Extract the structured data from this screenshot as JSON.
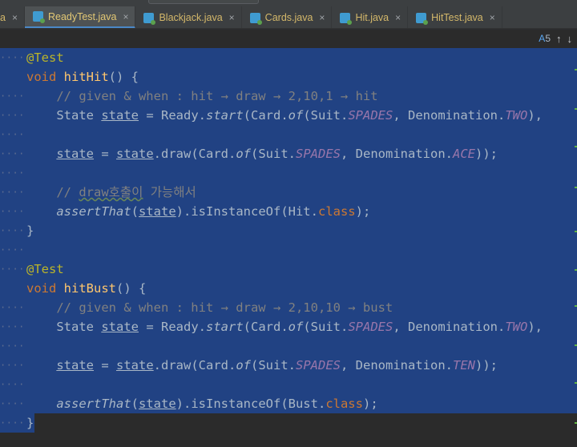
{
  "tabs": [
    {
      "label": "a",
      "active": false,
      "icon": "none"
    },
    {
      "label": "ReadyTest.java",
      "active": true,
      "icon": "java-class-icon"
    },
    {
      "label": "Blackjack.java",
      "active": false,
      "icon": "java-class-icon"
    },
    {
      "label": "Cards.java",
      "active": false,
      "icon": "java-class-icon"
    },
    {
      "label": "Hit.java",
      "active": false,
      "icon": "java-class-icon"
    },
    {
      "label": "HitTest.java",
      "active": false,
      "icon": "java-class-icon"
    }
  ],
  "close_glyph": "×",
  "toolbar": {
    "warning_count": "5",
    "up_glyph": "↑",
    "down_glyph": "↓",
    "warning_glyph": "A"
  },
  "dots": "····",
  "code": {
    "l1": {
      "ann": "@Test"
    },
    "l2": {
      "kw": "void",
      "name": "hitHit",
      "rest": "() {"
    },
    "l3": {
      "cm": "// given & when : hit → draw → 2,10,1 → hit"
    },
    "l4": {
      "a": "State ",
      "v1": "state",
      "b": " = Ready.",
      "m": "start",
      "c": "(Card.",
      "m2": "of",
      "d": "(Suit.",
      "s1": "SPADES",
      "e": ", Denomination.",
      "s2": "TWO",
      "f": "),"
    },
    "l6": {
      "v1": "state",
      "a": " = ",
      "v2": "state",
      "b": ".draw(Card.",
      "m": "of",
      "c": "(Suit.",
      "s1": "SPADES",
      "d": ", Denomination.",
      "s2": "ACE",
      "e": "));"
    },
    "l8": {
      "cm1": "// ",
      "cm2": "draw호출이",
      "cm3": " 가능해서"
    },
    "l9": {
      "m": "assertThat",
      "a": "(",
      "v": "state",
      "b": ").isInstanceOf(Hit.",
      "kw": "class",
      "c": ");"
    },
    "l10": {
      "t": "}"
    },
    "l12": {
      "ann": "@Test"
    },
    "l13": {
      "kw": "void",
      "name": "hitBust",
      "rest": "() {"
    },
    "l14": {
      "cm": "// given & when : hit → draw → 2,10,10 → bust"
    },
    "l15": {
      "a": "State ",
      "v1": "state",
      "b": " = Ready.",
      "m": "start",
      "c": "(Card.",
      "m2": "of",
      "d": "(Suit.",
      "s1": "SPADES",
      "e": ", Denomination.",
      "s2": "TWO",
      "f": "),"
    },
    "l17": {
      "v1": "state",
      "a": " = ",
      "v2": "state",
      "b": ".draw(Card.",
      "m": "of",
      "c": "(Suit.",
      "s1": "SPADES",
      "d": ", Denomination.",
      "s2": "TEN",
      "e": "));"
    },
    "l19": {
      "m": "assertThat",
      "a": "(",
      "v": "state",
      "b": ").isInstanceOf(Bust.",
      "kw": "class",
      "c": ");"
    },
    "l20": {
      "t": "}"
    }
  },
  "colors": {
    "selection": "#214283",
    "keyword": "#cc7832",
    "annotation": "#bbb529",
    "function": "#ffc66d",
    "static": "#9876aa",
    "comment": "#808080"
  }
}
